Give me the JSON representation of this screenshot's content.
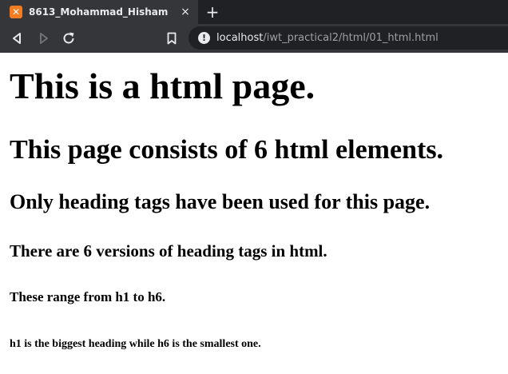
{
  "browser": {
    "tab": {
      "title": "8613_Mohammad_Hisham",
      "favicon": "xampp-icon",
      "close_icon": "×"
    },
    "new_tab_icon": "+",
    "nav": {
      "back": "back-icon",
      "forward": "forward-icon",
      "reload": "reload-icon",
      "bookmark": "bookmark-icon"
    },
    "address": {
      "info_icon": "!",
      "host": "localhost",
      "path": "/iwt_practical2/html/01_html.html"
    },
    "colors": {
      "tabbar": "#202124",
      "toolbar": "#35363a",
      "text": "#e8eaed",
      "muted": "#9aa0a6"
    }
  },
  "page": {
    "h1": "This is a html page.",
    "h2": "This page consists of 6 html elements.",
    "h3": "Only heading tags have been used for this page.",
    "h4": "There are 6 versions of heading tags in html.",
    "h5": "These range from h1 to h6.",
    "h6": "h1 is the biggest heading while h6 is the smallest one."
  }
}
